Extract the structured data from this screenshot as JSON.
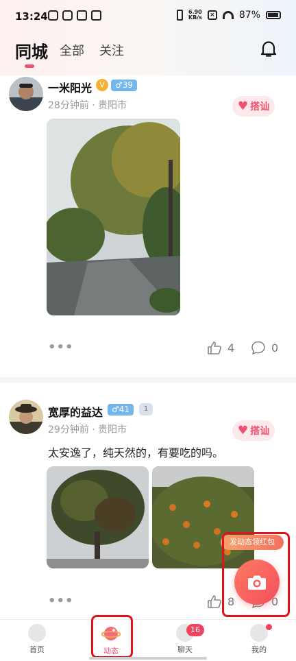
{
  "status_bar": {
    "time": "13:24",
    "net_speed_value": "6.90",
    "net_speed_unit": "KB/s",
    "battery": "87%"
  },
  "header": {
    "tabs": [
      {
        "label": "同城",
        "active": true
      },
      {
        "label": "全部",
        "active": false
      },
      {
        "label": "关注",
        "active": false
      }
    ]
  },
  "posts": [
    {
      "username": "一米阳光",
      "verified_icon": "V",
      "gender_age": "♂39",
      "time_location": "28分钟前 · 贵阳市",
      "chat_label": "搭讪",
      "likes": "4",
      "comments": "0"
    },
    {
      "username": "宽厚的益达",
      "gender_age": "♂41",
      "level": "1",
      "time_location": "29分钟前 · 贵阳市",
      "chat_label": "搭讪",
      "caption": "太安逸了，纯天然的，有要吃的吗。",
      "likes": "8",
      "comments": "0"
    }
  ],
  "floating": {
    "tip": "发动态领红包"
  },
  "bottom_nav": {
    "items": [
      {
        "label": "首页"
      },
      {
        "label": "动态"
      },
      {
        "label": "聊天"
      },
      {
        "label": "我的"
      }
    ],
    "chat_badge": "16"
  },
  "colors": {
    "accent": "#f0506e",
    "highlight": "#e0121a",
    "gender_badge": "#72b6ec"
  }
}
